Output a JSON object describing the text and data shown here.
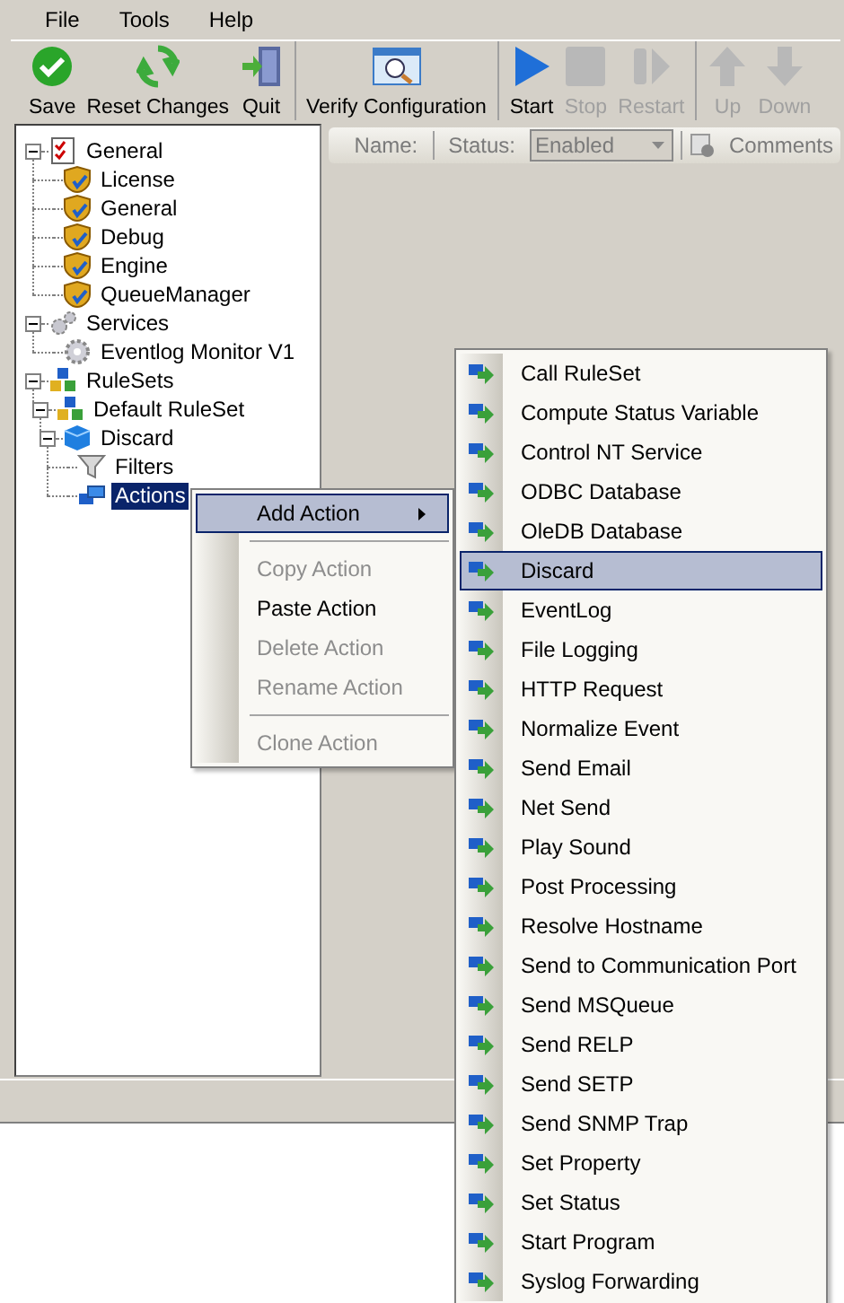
{
  "menu": [
    "File",
    "Tools",
    "Help"
  ],
  "toolbar": [
    [
      {
        "label": "Save",
        "kind": "check",
        "disabled": false
      },
      {
        "label": "Reset Changes",
        "kind": "refresh",
        "disabled": false
      },
      {
        "label": "Quit",
        "kind": "door",
        "disabled": false
      }
    ],
    [
      {
        "label": "Verify Configuration",
        "kind": "verify",
        "disabled": false
      }
    ],
    [
      {
        "label": "Start",
        "kind": "play",
        "disabled": false
      },
      {
        "label": "Stop",
        "kind": "stop",
        "disabled": true
      },
      {
        "label": "Restart",
        "kind": "restart",
        "disabled": true
      }
    ],
    [
      {
        "label": "Up",
        "kind": "up",
        "disabled": true
      },
      {
        "label": "Down",
        "kind": "down",
        "disabled": true
      }
    ]
  ],
  "details_bar": {
    "name_label": "Name:",
    "status_label": "Status:",
    "status_value": "Enabled",
    "status_disabled": true,
    "comments": "Comments"
  },
  "tree": [
    {
      "label": "General",
      "kind": "checklist",
      "expanded": true,
      "selected": false,
      "children": [
        {
          "label": "License",
          "kind": "shield",
          "selected": false
        },
        {
          "label": "General",
          "kind": "shield",
          "selected": false
        },
        {
          "label": "Debug",
          "kind": "shield",
          "selected": false
        },
        {
          "label": "Engine",
          "kind": "shield",
          "selected": false
        },
        {
          "label": "QueueManager",
          "kind": "shield",
          "selected": false
        }
      ]
    },
    {
      "label": "Services",
      "kind": "gears",
      "expanded": true,
      "selected": false,
      "children": [
        {
          "label": "Eventlog Monitor V1",
          "kind": "gear",
          "selected": false
        }
      ]
    },
    {
      "label": "RuleSets",
      "kind": "cubes",
      "expanded": true,
      "selected": false,
      "children": [
        {
          "label": "Default RuleSet",
          "kind": "cubes",
          "expanded": true,
          "selected": false,
          "children": [
            {
              "label": "Discard",
              "kind": "cube",
              "expanded": true,
              "selected": false,
              "children": [
                {
                  "label": "Filters",
                  "kind": "funnel",
                  "selected": false
                },
                {
                  "label": "Actions",
                  "kind": "actions",
                  "selected": true
                }
              ]
            }
          ]
        }
      ]
    }
  ],
  "context_menu": [
    {
      "kind": "submenu",
      "label": "Add Action",
      "disabled": false,
      "selected": true
    },
    {
      "kind": "separator"
    },
    {
      "kind": "item",
      "label": "Copy Action",
      "disabled": true,
      "selected": false
    },
    {
      "kind": "item",
      "label": "Paste Action",
      "disabled": false,
      "selected": false
    },
    {
      "kind": "item",
      "label": "Delete Action",
      "disabled": true,
      "selected": false
    },
    {
      "kind": "item",
      "label": "Rename Action",
      "disabled": true,
      "selected": false
    },
    {
      "kind": "separator"
    },
    {
      "kind": "item",
      "label": "Clone Action",
      "disabled": true,
      "selected": false
    }
  ],
  "submenu": [
    {
      "label": "Call RuleSet",
      "selected": false
    },
    {
      "label": "Compute Status Variable",
      "selected": false
    },
    {
      "label": "Control NT Service",
      "selected": false
    },
    {
      "label": "ODBC Database",
      "selected": false
    },
    {
      "label": "OleDB Database",
      "selected": false
    },
    {
      "label": "Discard",
      "selected": true
    },
    {
      "label": "EventLog",
      "selected": false
    },
    {
      "label": "File Logging",
      "selected": false
    },
    {
      "label": "HTTP Request",
      "selected": false
    },
    {
      "label": "Normalize Event",
      "selected": false
    },
    {
      "label": "Send Email",
      "selected": false
    },
    {
      "label": "Net Send",
      "selected": false
    },
    {
      "label": "Play Sound",
      "selected": false
    },
    {
      "label": "Post Processing",
      "selected": false
    },
    {
      "label": "Resolve Hostname",
      "selected": false
    },
    {
      "label": "Send to Communication Port",
      "selected": false
    },
    {
      "label": "Send MSQueue",
      "selected": false
    },
    {
      "label": "Send RELP",
      "selected": false
    },
    {
      "label": "Send SETP",
      "selected": false
    },
    {
      "label": "Send SNMP Trap",
      "selected": false
    },
    {
      "label": "Set Property",
      "selected": false
    },
    {
      "label": "Set Status",
      "selected": false
    },
    {
      "label": "Start Program",
      "selected": false
    },
    {
      "label": "Syslog Forwarding",
      "selected": false
    }
  ]
}
